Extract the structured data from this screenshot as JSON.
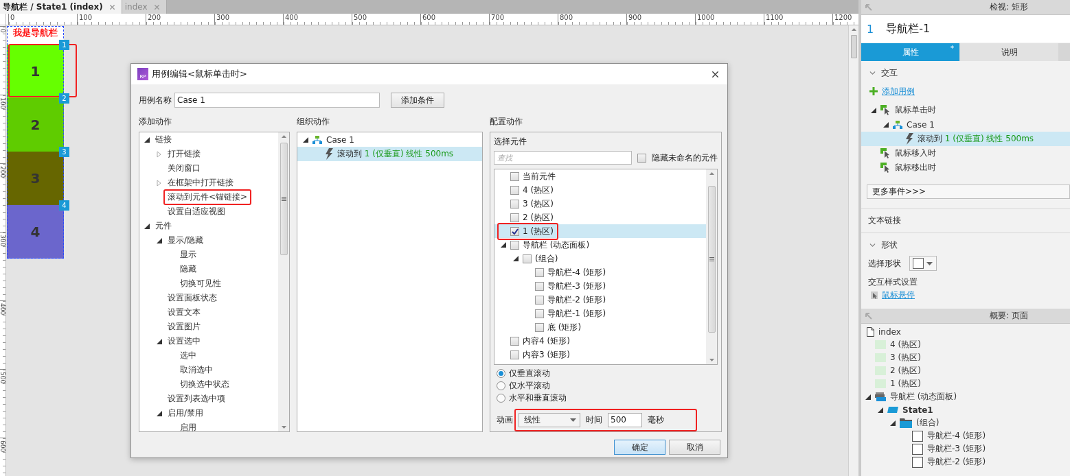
{
  "tabs": [
    {
      "label": "导航栏 / State1 (index)",
      "selected": true
    },
    {
      "label": "index",
      "selected": false
    }
  ],
  "ruler": {
    "x_labels": [
      "0",
      "100",
      "200",
      "300",
      "400",
      "500",
      "600",
      "700",
      "800",
      "900",
      "1000",
      "1100",
      "1200"
    ],
    "y_labels": [
      "0",
      "100",
      "200",
      "300",
      "400",
      "500",
      "600"
    ]
  },
  "nav_widget": {
    "title": "我是导航栏",
    "items": [
      {
        "label": "1",
        "badge": "1",
        "color": "#66ff00",
        "highlighted": true
      },
      {
        "label": "2",
        "badge": "2",
        "color": "#5fcc00",
        "highlighted": false
      },
      {
        "label": "3",
        "badge": "3",
        "color": "#666600",
        "highlighted": false
      },
      {
        "label": "4",
        "badge": "4",
        "color": "#6b66cc",
        "highlighted": false
      }
    ]
  },
  "dialog": {
    "logo_text": "RP",
    "title": "用例编辑<鼠标单击时>",
    "case_name_label": "用例名称",
    "case_name": "Case 1",
    "add_condition": "添加条件",
    "add_actions": {
      "heading": "添加动作",
      "tree": [
        {
          "label": "链接",
          "expanded": true,
          "highlighted": false,
          "children": [
            {
              "label": "打开链接",
              "expanded": false,
              "highlighted": false
            },
            {
              "label": "关闭窗口",
              "highlighted": false
            },
            {
              "label": "在框架中打开链接",
              "expanded": false,
              "highlighted": false
            },
            {
              "label": "滚动到元件<锚链接>",
              "highlighted": true
            },
            {
              "label": "设置自适应视图",
              "highlighted": false
            }
          ]
        },
        {
          "label": "元件",
          "expanded": true,
          "highlighted": false,
          "children": [
            {
              "label": "显示/隐藏",
              "expanded": true,
              "highlighted": false,
              "children": [
                {
                  "label": "显示",
                  "highlighted": false
                },
                {
                  "label": "隐藏",
                  "highlighted": false
                },
                {
                  "label": "切换可见性",
                  "highlighted": false
                }
              ]
            },
            {
              "label": "设置面板状态",
              "highlighted": false
            },
            {
              "label": "设置文本",
              "highlighted": false
            },
            {
              "label": "设置图片",
              "highlighted": false
            },
            {
              "label": "设置选中",
              "expanded": true,
              "highlighted": false,
              "children": [
                {
                  "label": "选中",
                  "highlighted": false
                },
                {
                  "label": "取消选中",
                  "highlighted": false
                },
                {
                  "label": "切换选中状态",
                  "highlighted": false
                }
              ]
            },
            {
              "label": "设置列表选中项",
              "highlighted": false
            },
            {
              "label": "启用/禁用",
              "expanded": true,
              "highlighted": false,
              "children": [
                {
                  "label": "启用",
                  "highlighted": false
                }
              ]
            }
          ]
        }
      ]
    },
    "organize": {
      "heading": "组织动作",
      "case": {
        "label": "Case 1",
        "expanded": true
      },
      "actions": [
        {
          "verb": "滚动到",
          "detail": "1 (仅垂直) 线性 500ms",
          "selected": true
        }
      ]
    },
    "configure": {
      "heading": "配置动作",
      "select_label": "选择元件",
      "search_placeholder": "查找",
      "hide_unnamed": {
        "label": "隐藏未命名的元件",
        "checked": false
      },
      "widgets": [
        {
          "label": "当前元件",
          "checked": false,
          "selected": false,
          "highlighted": false
        },
        {
          "label": "4 (热区)",
          "checked": false,
          "selected": false,
          "highlighted": false
        },
        {
          "label": "3 (热区)",
          "checked": false,
          "selected": false,
          "highlighted": false
        },
        {
          "label": "2 (热区)",
          "checked": false,
          "selected": false,
          "highlighted": false
        },
        {
          "label": "1 (热区)",
          "checked": true,
          "selected": true,
          "highlighted": true
        },
        {
          "label": "导航栏 (动态面板)",
          "expanded": true,
          "checked": false,
          "selected": false,
          "highlighted": false,
          "children": [
            {
              "label": "(组合)",
              "expanded": true,
              "checked": false,
              "selected": false,
              "highlighted": false,
              "children": [
                {
                  "label": "导航栏-4 (矩形)",
                  "checked": false,
                  "selected": false,
                  "highlighted": false
                },
                {
                  "label": "导航栏-3 (矩形)",
                  "checked": false,
                  "selected": false,
                  "highlighted": false
                },
                {
                  "label": "导航栏-2 (矩形)",
                  "checked": false,
                  "selected": false,
                  "highlighted": false
                },
                {
                  "label": "导航栏-1 (矩形)",
                  "checked": false,
                  "selected": false,
                  "highlighted": false
                },
                {
                  "label": "底 (矩形)",
                  "checked": false,
                  "selected": false,
                  "highlighted": false
                }
              ]
            }
          ]
        },
        {
          "label": "内容4 (矩形)",
          "checked": false,
          "selected": false,
          "highlighted": false
        },
        {
          "label": "内容3 (矩形)",
          "checked": false,
          "selected": false,
          "highlighted": false
        }
      ],
      "scroll_options": [
        {
          "label": "仅垂直滚动",
          "selected": true
        },
        {
          "label": "仅水平滚动",
          "selected": false
        },
        {
          "label": "水平和垂直滚动",
          "selected": false
        }
      ],
      "animation_label": "动画",
      "animation": "线性",
      "time_label": "时间",
      "time": "500",
      "unit": "毫秒",
      "animation_highlighted": true
    },
    "buttons": [
      {
        "label": "确定",
        "kind": "primary"
      },
      {
        "label": "取消",
        "kind": "secondary"
      }
    ]
  },
  "inspector": {
    "title": "检视: 矩形",
    "shape_number": "1",
    "shape_name": "导航栏-1",
    "tabs": [
      {
        "label": "属性",
        "badge": "*",
        "selected": true
      },
      {
        "label": "说明",
        "selected": false
      }
    ],
    "interaction": {
      "heading": "交互",
      "expanded": true,
      "add_case": "添加用例",
      "events": [
        {
          "kind": "event",
          "label": "鼠标单击时",
          "expanded": true,
          "children": [
            {
              "kind": "case",
              "label": "Case 1",
              "expanded": true,
              "children": [
                {
                  "kind": "action",
                  "verb": "滚动到",
                  "detail": "1 (仅垂直) 线性 500ms",
                  "selected": true
                }
              ]
            }
          ]
        },
        {
          "kind": "event",
          "label": "鼠标移入时"
        },
        {
          "kind": "event",
          "label": "鼠标移出时"
        }
      ],
      "more_events": "更多事件>>>"
    },
    "text_link": "文本链接",
    "shape": {
      "heading": "形状",
      "expanded": true,
      "select_shape_label": "选择形状",
      "interaction_style": "交互样式设置",
      "hover_link": "鼠标悬停"
    }
  },
  "outline": {
    "title": "概要: 页面",
    "page": "index",
    "items": [
      {
        "kind": "hotspot",
        "label": "4 (热区)"
      },
      {
        "kind": "hotspot",
        "label": "3 (热区)"
      },
      {
        "kind": "hotspot",
        "label": "2 (热区)"
      },
      {
        "kind": "hotspot",
        "label": "1 (热区)"
      },
      {
        "kind": "panel",
        "label": "导航栏 (动态面板)",
        "expanded": true,
        "children": [
          {
            "kind": "state",
            "label": "State1",
            "expanded": true,
            "children": [
              {
                "kind": "folder",
                "label": "(组合)",
                "expanded": true,
                "children": [
                  {
                    "kind": "rect",
                    "label": "导航栏-4 (矩形)"
                  },
                  {
                    "kind": "rect",
                    "label": "导航栏-3 (矩形)"
                  },
                  {
                    "kind": "rect",
                    "label": "导航栏-2 (矩形)"
                  }
                ]
              }
            ]
          }
        ]
      }
    ]
  }
}
